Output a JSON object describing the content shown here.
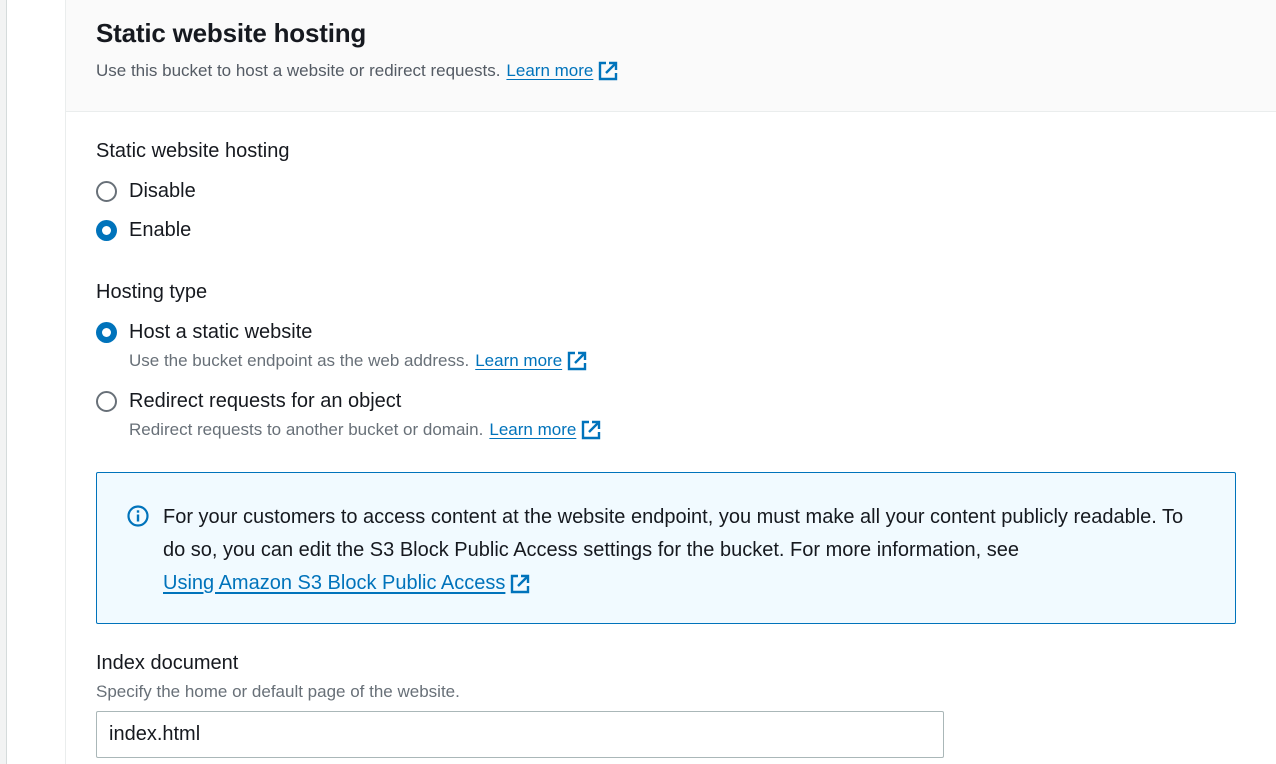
{
  "header": {
    "title": "Static website hosting",
    "description": "Use this bucket to host a website or redirect requests.",
    "learn_more": "Learn more"
  },
  "hosting": {
    "label": "Static website hosting",
    "options": [
      {
        "label": "Disable",
        "selected": false
      },
      {
        "label": "Enable",
        "selected": true
      }
    ]
  },
  "hosting_type": {
    "label": "Hosting type",
    "options": [
      {
        "label": "Host a static website",
        "description": "Use the bucket endpoint as the web address.",
        "learn_more": "Learn more",
        "selected": true
      },
      {
        "label": "Redirect requests for an object",
        "description": "Redirect requests to another bucket or domain.",
        "learn_more": "Learn more",
        "selected": false
      }
    ]
  },
  "alert": {
    "text": "For your customers to access content at the website endpoint, you must make all your content publicly readable. To do so, you can edit the S3 Block Public Access settings for the bucket. For more information, see",
    "link": "Using Amazon S3 Block Public Access"
  },
  "index_document": {
    "label": "Index document",
    "description": "Specify the home or default page of the website.",
    "value": "index.html"
  },
  "colors": {
    "link": "#0073bb",
    "alert_bg": "#f1faff",
    "alert_border": "#0073bb",
    "radio_checked": "#0073bb"
  }
}
